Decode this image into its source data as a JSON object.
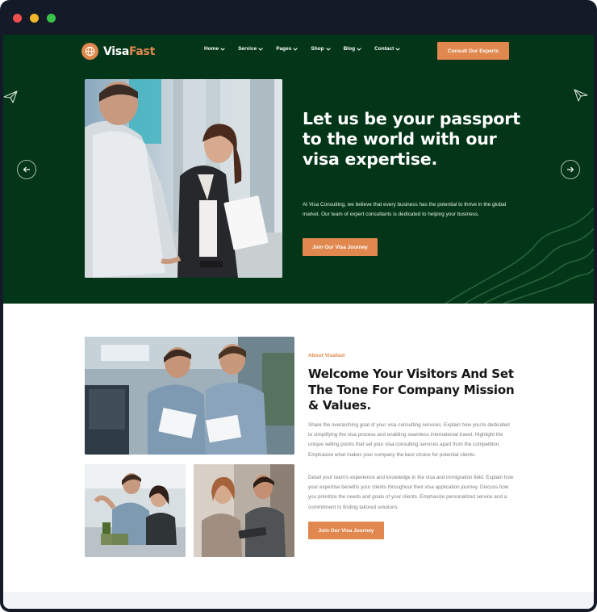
{
  "brand": {
    "logo_visa": "Visa",
    "logo_fast": "Fast",
    "accent_color": "#e0884d",
    "hero_bg_color": "#033618"
  },
  "nav": {
    "items": [
      {
        "label": "Home"
      },
      {
        "label": "Service"
      },
      {
        "label": "Pages"
      },
      {
        "label": "Shop"
      },
      {
        "label": "Blog"
      },
      {
        "label": "Contact"
      }
    ],
    "cta_label": "Consult Our Experts"
  },
  "hero": {
    "title": "Let us be your passport to the world with our visa expertise.",
    "description": "At Visa Consulting, we believe that every business has the potential to thrive in the global market. Our team of expert consultants is dedicated to helping your business.",
    "button_label": "Join Our Visa Journey",
    "prev_icon": "arrow-left-icon",
    "next_icon": "arrow-right-icon"
  },
  "about": {
    "eyebrow": "About Visafast",
    "title": "Welcome Your Visitors And Set The Tone For Company Mission & Values.",
    "paragraph1": "Share the overarching goal of your visa consulting services. Explain how you're dedicated to simplifying the visa process and enabling seamless international travel. Highlight the unique selling points that set your visa consulting services apart from the competition. Emphasize what makes your company the best choice for potential clients.",
    "paragraph2": "Detail your team's experience and knowledge in the visa and immigration field. Explain how your expertise benefits your clients throughout their visa application journey. Discuss how you prioritize the needs and goals of your clients. Emphasize personalized service and a commitment to finding tailored solutions.",
    "button_label": "Join Our Visa Journey"
  }
}
